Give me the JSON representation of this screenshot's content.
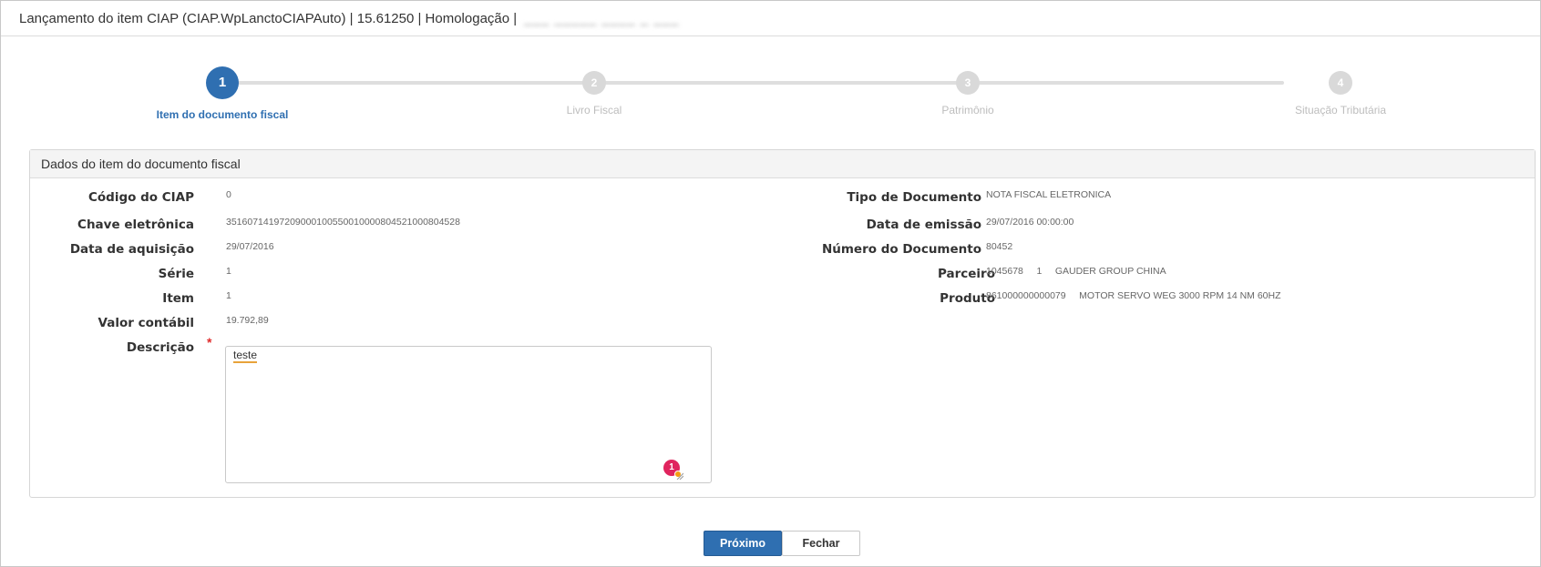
{
  "window": {
    "title": "Lançamento do item CIAP (CIAP.WpLanctoCIAPAuto) | 15.61250 | Homologação |",
    "title_suffix_redacted": "___ _____ ____ _ ___"
  },
  "stepper": {
    "steps": [
      {
        "number": "1",
        "label": "Item do documento fiscal",
        "active": true
      },
      {
        "number": "2",
        "label": "Livro Fiscal",
        "active": false
      },
      {
        "number": "3",
        "label": "Patrimônio",
        "active": false
      },
      {
        "number": "4",
        "label": "Situação Tributária",
        "active": false
      }
    ]
  },
  "panel": {
    "header": "Dados do item do documento fiscal",
    "left_fields": [
      {
        "label": "Código do CIAP",
        "value": "0"
      },
      {
        "label": "Chave eletrônica",
        "value": "35160714197209000100550010000804521000804528"
      },
      {
        "label": "Data de aquisição",
        "value": "29/07/2016"
      },
      {
        "label": "Série",
        "value": "1"
      },
      {
        "label": "Item",
        "value": "1"
      },
      {
        "label": "Valor contábil",
        "value": "19.792,89"
      },
      {
        "label": "Descrição",
        "value": ""
      }
    ],
    "right_fields": [
      {
        "label": "Tipo de Documento",
        "value": "NOTA FISCAL ELETRONICA"
      },
      {
        "label": "Data de emissão",
        "value": "29/07/2016 00:00:00"
      },
      {
        "label": "Número do Documento",
        "value": "80452"
      },
      {
        "label": "Parceiro",
        "value": "1045678     1     GAUDER GROUP CHINA"
      },
      {
        "label": "Produto",
        "value": "861000000000079     MOTOR SERVO WEG 3000 RPM 14 NM 60HZ"
      }
    ],
    "required_marker": "*",
    "description": {
      "value": "teste",
      "badge": "1"
    }
  },
  "buttons": {
    "next": "Próximo",
    "close": "Fechar"
  },
  "colors": {
    "accent": "#2f6fb1",
    "inactive_step": "#d9d9d9",
    "required": "#e02b2b",
    "badge": "#e0245e"
  }
}
